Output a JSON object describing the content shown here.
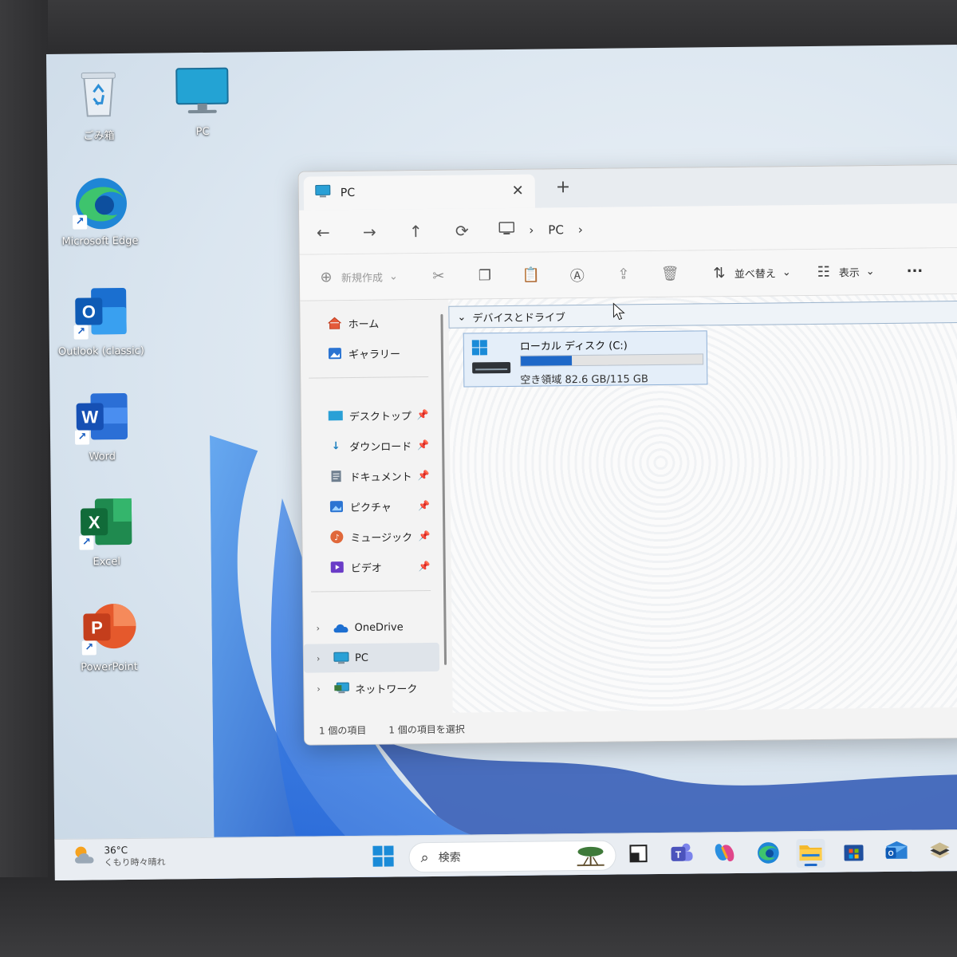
{
  "desktop": {
    "icons": [
      {
        "label": "ごみ箱"
      },
      {
        "label": "PC"
      },
      {
        "label": "Microsoft Edge"
      },
      {
        "label": "Outlook (classic)"
      },
      {
        "label": "Word"
      },
      {
        "label": "Excel"
      },
      {
        "label": "PowerPoint"
      }
    ]
  },
  "explorer": {
    "tab": {
      "title": "PC",
      "close": "✕",
      "add": "+"
    },
    "nav": {
      "back": "←",
      "forward": "→",
      "up": "↑",
      "refresh": "⟳",
      "breadcrumb": [
        "PC"
      ],
      "sep": "›"
    },
    "commands": {
      "new": "新規作成",
      "sort": "並べ替え",
      "view": "表示",
      "more": "···",
      "dropdown": "⌄"
    },
    "sidebar": {
      "top": [
        {
          "label": "ホーム"
        },
        {
          "label": "ギャラリー"
        }
      ],
      "pinned": [
        {
          "label": "デスクトップ"
        },
        {
          "label": "ダウンロード"
        },
        {
          "label": "ドキュメント"
        },
        {
          "label": "ピクチャ"
        },
        {
          "label": "ミュージック"
        },
        {
          "label": "ビデオ"
        }
      ],
      "tree": [
        {
          "label": "OneDrive"
        },
        {
          "label": "PC"
        },
        {
          "label": "ネットワーク"
        }
      ],
      "pin_glyph": "📌",
      "chevron": "›"
    },
    "content": {
      "group_header": "デバイスとドライブ",
      "group_chevron": "⌄",
      "drive": {
        "name": "ローカル ディスク (C:)",
        "free_text": "空き領域 82.6 GB/115 GB",
        "used_fraction": 0.28
      }
    },
    "status": {
      "count": "1 個の項目",
      "selected": "1 個の項目を選択"
    }
  },
  "taskbar": {
    "weather": {
      "temp": "36°C",
      "desc": "くもり時々晴れ"
    },
    "search_placeholder": "検索"
  },
  "colors": {
    "accent": "#1e68c8",
    "drive_fill": "#1e68c8",
    "selection": "#dfe4ea"
  }
}
